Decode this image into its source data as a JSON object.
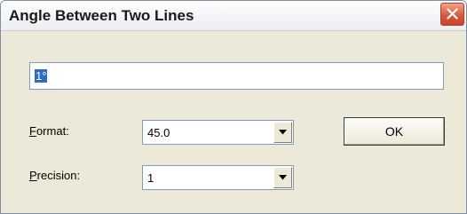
{
  "window": {
    "title": "Angle Between Two Lines"
  },
  "angle_field": {
    "value": "1°"
  },
  "format": {
    "label_accel": "F",
    "label_rest": "ormat:",
    "selected": "45.0"
  },
  "precision": {
    "label_accel": "P",
    "label_rest": "recision:",
    "selected": "1"
  },
  "buttons": {
    "ok_label": "OK"
  },
  "colors": {
    "dialog_bg": "#ece9d8",
    "close_button": "#d75a3e",
    "selection_highlight": "#316ac5"
  },
  "icons": {
    "close": "close-icon",
    "dropdown": "chevron-down-icon"
  }
}
